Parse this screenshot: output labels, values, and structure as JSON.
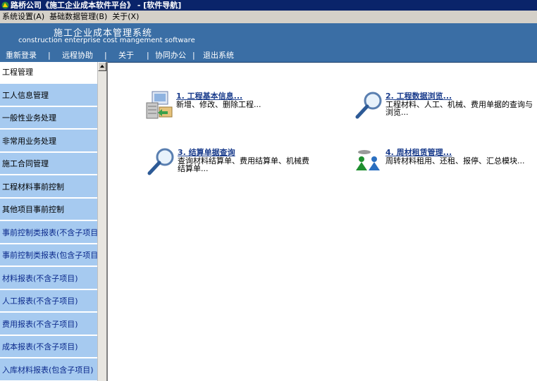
{
  "window": {
    "title": "路桥公司《施工企业成本软件平台》 - [软件导航]"
  },
  "menubar": [
    "系统设置(A)",
    "基础数据管理(B)",
    "关于(X)"
  ],
  "banner": {
    "title": "施工企业成本管理系统",
    "subtitle": "construction enterprise cost mangement software"
  },
  "navbar": {
    "items": [
      "重新登录",
      "远程协助",
      "关于",
      "协同办公",
      "退出系统"
    ],
    "separator": "|"
  },
  "sidebar": {
    "items": [
      "工程管理",
      "工人信息管理",
      "一般性业务处理",
      "非常用业务处理",
      "施工合同管理",
      "工程材料事前控制",
      "其他项目事前控制",
      "事前控制类报表(不含子项目)",
      "事前控制类报表(包含子项目)",
      "材料报表(不含子项目)",
      "人工报表(不含子项目)",
      "费用报表(不含子项目)",
      "成本报表(不含子项目)",
      "入库材料报表(包含子项目)"
    ]
  },
  "cards": [
    {
      "title": "1. 工程基本信息...",
      "desc1": "新增、修改、删除工程...",
      "desc2": "",
      "icon": "database-monitor-icon"
    },
    {
      "title": "2. 工程数据浏览...",
      "desc1": "工程材料、人工、机械、费用单据的查询与",
      "desc2": "浏览...",
      "icon": "magnifier-icon"
    },
    {
      "title": "3. 结算单据查询",
      "desc1": "查询材料结算单、费用结算单、机械费",
      "desc2": "结算单...",
      "icon": "magnifier-icon"
    },
    {
      "title": "4. 周材租赁管理...",
      "desc1": "周转材料租用、还租、报停、汇总模块...",
      "desc2": "",
      "icon": "users-network-icon"
    }
  ],
  "colors": {
    "titlebar": "#0a246a",
    "banner": "#3a6ea5",
    "sidebar": "#a6caf0",
    "link": "#1a3c8c"
  }
}
